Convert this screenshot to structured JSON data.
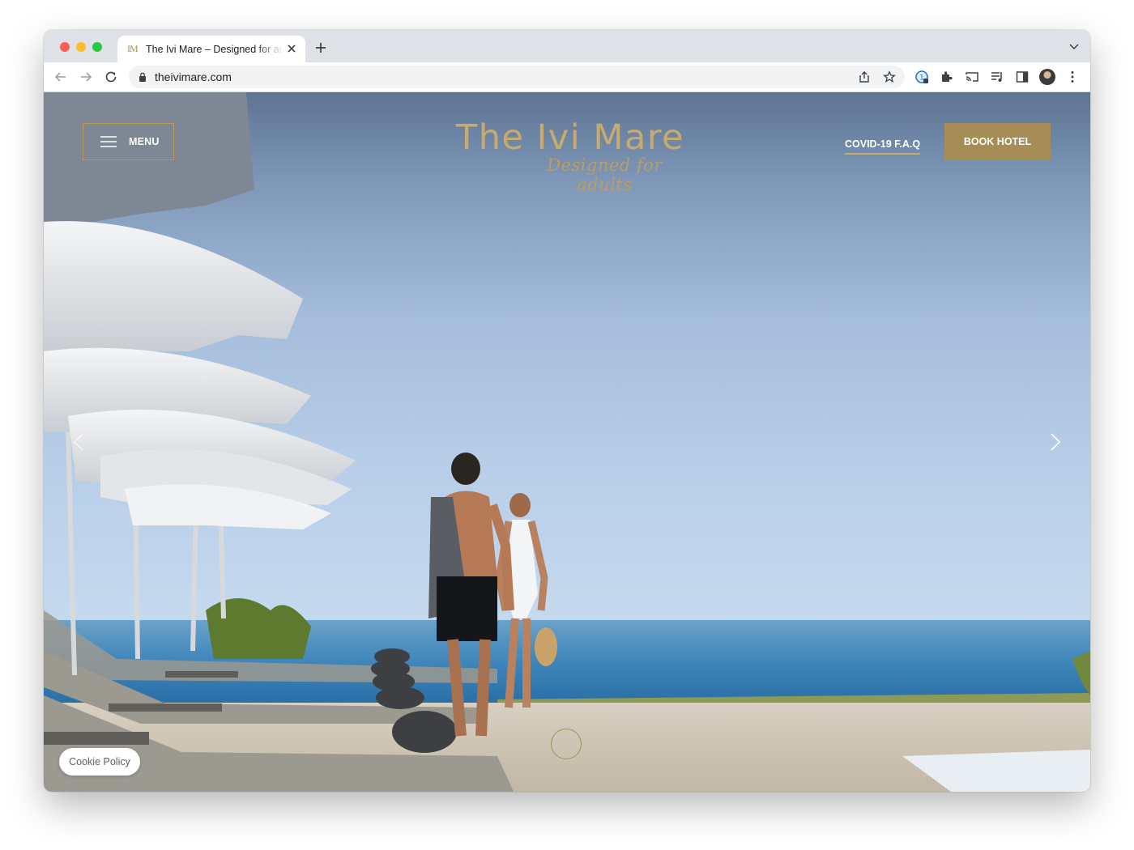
{
  "browser": {
    "tab_title": "The Ivi Mare – Designed for adults",
    "tab_favicon": "IM",
    "url": "theivimare.com",
    "icons": [
      "back-icon",
      "forward-icon",
      "reload-icon",
      "lock-icon",
      "share-icon",
      "star-icon",
      "password-extension-icon",
      "extensions-icon",
      "cast-icon",
      "media-queue-icon",
      "side-panel-icon",
      "avatar",
      "more-menu-icon"
    ]
  },
  "site": {
    "menu_label": "MENU",
    "logo_name": "The Ivi Mare",
    "logo_tagline": "Designed for adults",
    "faq_link": "COVID-19 F.A.Q",
    "book_button": "BOOK HOTEL",
    "cookie_button": "Cookie Policy",
    "accent_color": "#a68d55"
  }
}
